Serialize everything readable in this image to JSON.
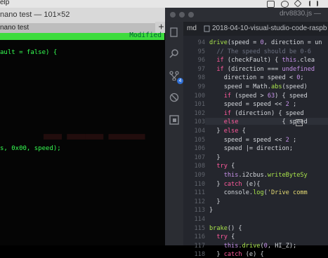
{
  "menubar": {
    "left_text": "elp"
  },
  "terminal": {
    "title": "nano test — 101×52",
    "tab": "nano test",
    "status": "Modified",
    "lines": [
      "ault = false) {",
      "s, 0x00, speed);"
    ]
  },
  "editor": {
    "window_title": "drv8830.js —",
    "sidebar_tab": "md",
    "breadcrumb": "2018-04-10-visual-studio-code-raspb",
    "badge": "4",
    "line_numbers": [
      "94",
      "95",
      "96",
      "97",
      "98",
      "99",
      "100",
      "101",
      "102",
      "103",
      "104",
      "105",
      "106",
      "107",
      "108",
      "109",
      "110",
      "111",
      "112",
      "113",
      "114",
      "115",
      "116",
      "117",
      "118"
    ],
    "code": [
      "",
      "drive(speed = 0, direction = un",
      "  // The speed should be 0-6",
      "  if (checkFault) { this.clea",
      "  if (direction === undefined",
      "    direction = speed < 0;",
      "    speed = Math.abs(speed)",
      "    if (speed > 63) { speed",
      "    speed = speed << 2 ;",
      "    if (direction) { speed",
      "    else            { speed",
      "  } else {",
      "    speed = speed << 2 ;",
      "    speed |= direction;",
      "  }",
      "  try {",
      "    this.i2cbus.writeByteSy",
      "  } catch (e){",
      "    console.log('Drive comm",
      "  }",
      "}",
      "",
      "brake() {",
      "  try {",
      "    this.drive(0, HI_Z);",
      "  } catch (e) {"
    ]
  }
}
